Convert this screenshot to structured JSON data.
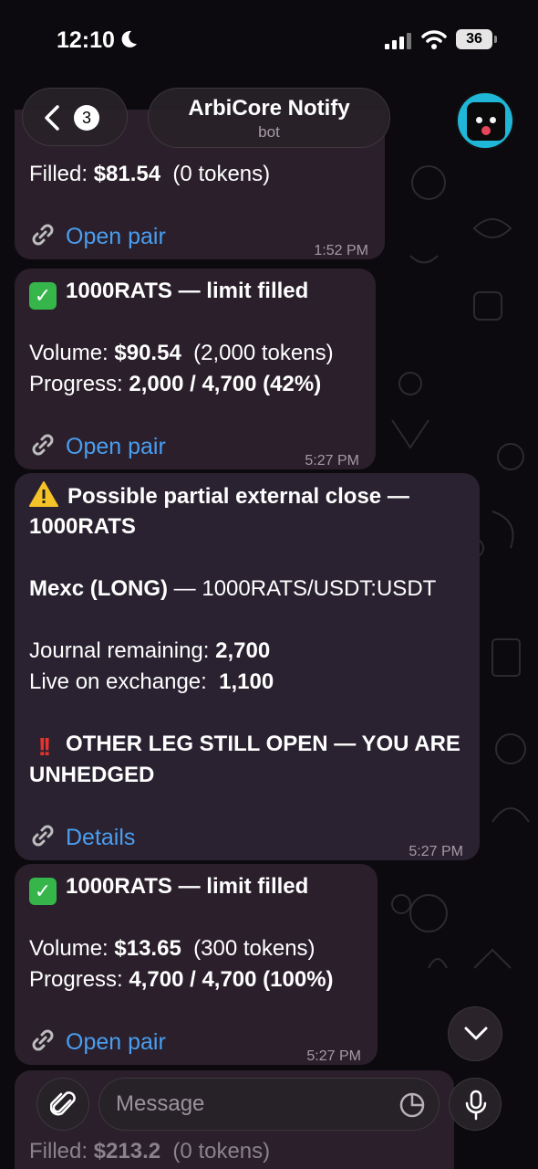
{
  "status_bar": {
    "time": "12:10",
    "battery": "36"
  },
  "header": {
    "unread_count": "3",
    "title": "ArbiCore Notify",
    "subtitle": "bot"
  },
  "messages": [
    {
      "lines": [
        {
          "label": "Filled: ",
          "value": "$81.54",
          "extra": "  (0 tokens)"
        }
      ],
      "link": "Open pair",
      "time": "1:52 PM"
    },
    {
      "title": "1000RATS — limit filled",
      "lines": [
        {
          "label": "Volume: ",
          "value": "$90.54",
          "extra": "  (2,000 tokens)"
        },
        {
          "label": "Progress: ",
          "value": "2,000 / 4,700 (42%)"
        }
      ],
      "link": "Open pair",
      "time": "5:27 PM"
    },
    {
      "title_line1": "Possible partial external close —",
      "title_line2": "1000RATS",
      "exchange": "Mexc (LONG)",
      "pair": " — 1000RATS/USDT:USDT",
      "journal_label": "Journal remaining: ",
      "journal_value": "2,700",
      "live_label": "Live on exchange:  ",
      "live_value": "1,100",
      "alert_line1": "OTHER LEG STILL OPEN — YOU ARE",
      "alert_line2": "UNHEDGED",
      "link": "Details",
      "time": "5:27 PM"
    },
    {
      "title": "1000RATS — limit filled",
      "lines": [
        {
          "label": "Volume: ",
          "value": "$13.65",
          "extra": "  (300 tokens)"
        },
        {
          "label": "Progress: ",
          "value": "4,700 / 4,700 (100%)"
        }
      ],
      "link": "Open pair",
      "time": "5:27 PM"
    },
    {
      "lines": [
        {
          "label": "Filled: ",
          "value": "$213.2",
          "extra": "  (0 tokens)"
        }
      ]
    }
  ],
  "composer": {
    "placeholder": "Message"
  },
  "colors": {
    "accent": "#4a9ef0",
    "bubble": "#2a1f2b",
    "check": "#35b54a",
    "alert": "#e8322c"
  }
}
